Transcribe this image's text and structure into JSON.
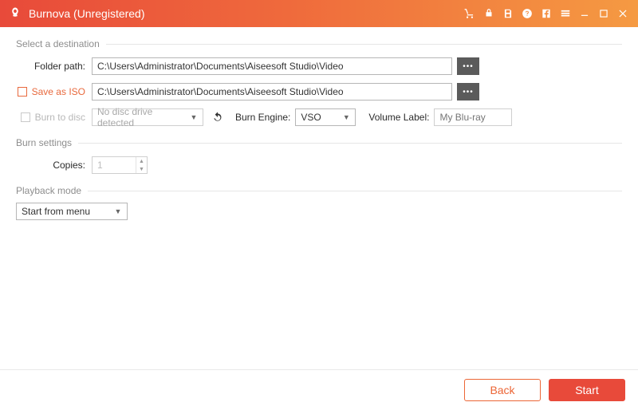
{
  "app": {
    "title": "Burnova (Unregistered)"
  },
  "sections": {
    "destination": "Select a destination",
    "burn_settings": "Burn settings",
    "playback_mode": "Playback mode"
  },
  "labels": {
    "folder_path": "Folder path:",
    "save_as_iso": "Save as ISO",
    "burn_to_disc": "Burn to disc",
    "burn_engine": "Burn Engine:",
    "volume_label": "Volume Label:",
    "copies": "Copies:"
  },
  "values": {
    "folder_path": "C:\\Users\\Administrator\\Documents\\Aiseesoft Studio\\Video",
    "iso_path": "C:\\Users\\Administrator\\Documents\\Aiseesoft Studio\\Video",
    "disc_drive": "No disc drive detected",
    "burn_engine": "VSO",
    "volume_placeholder": "My Blu-ray",
    "copies": "1",
    "playback_mode": "Start from menu"
  },
  "buttons": {
    "back": "Back",
    "start": "Start",
    "browse": "•••"
  }
}
